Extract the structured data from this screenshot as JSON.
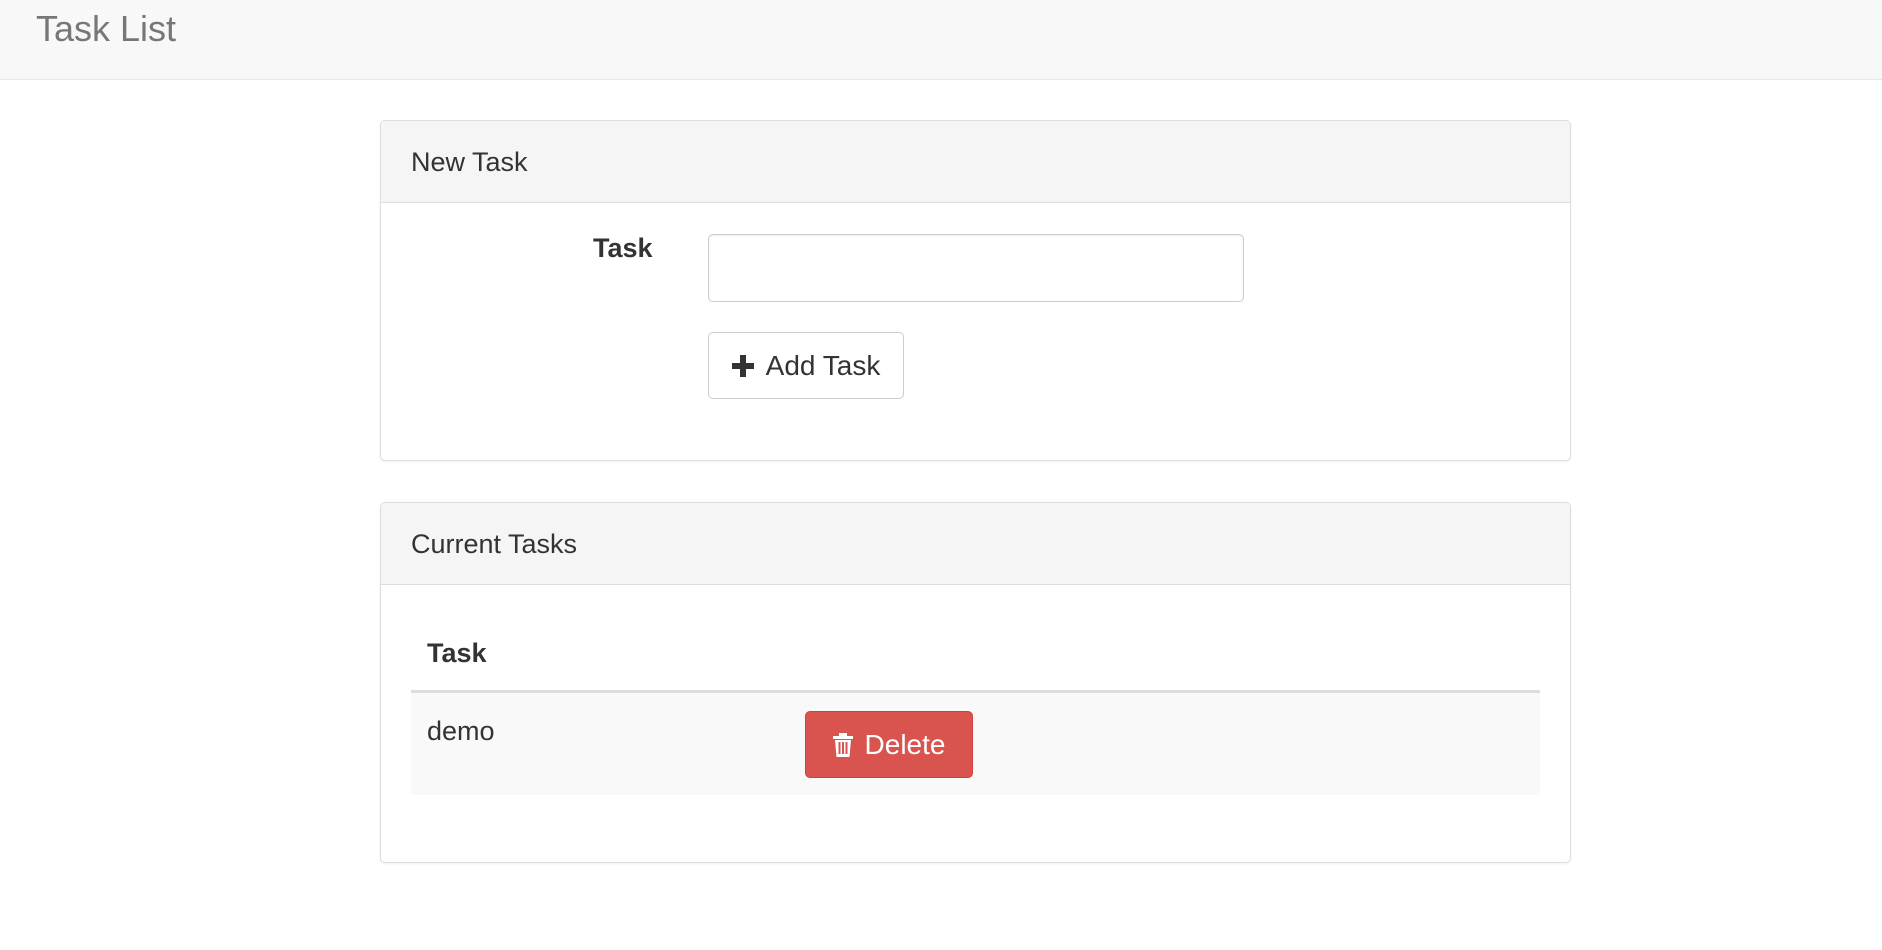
{
  "navbar": {
    "brand": "Task List"
  },
  "new_task_panel": {
    "heading": "New Task",
    "task_label": "Task",
    "task_input_value": "",
    "add_button_label": "Add Task"
  },
  "current_tasks_panel": {
    "heading": "Current Tasks",
    "column_header": "Task",
    "rows": [
      {
        "name": "demo",
        "delete_label": "Delete"
      }
    ]
  },
  "colors": {
    "delete_button": "#d9534f",
    "navbar_bg": "#f8f8f8",
    "panel_heading_bg": "#f5f5f5"
  }
}
